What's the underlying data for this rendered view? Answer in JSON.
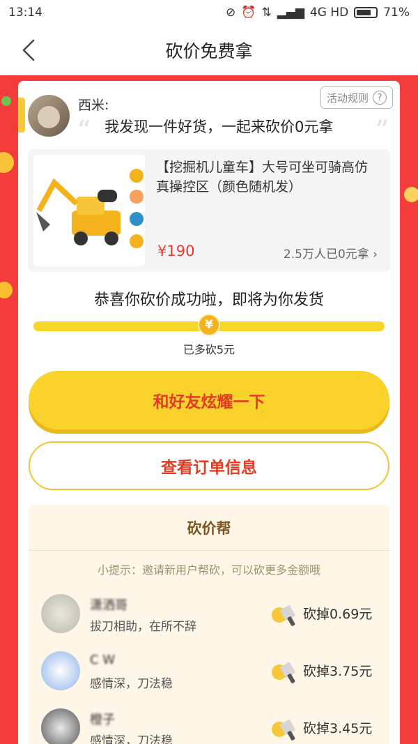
{
  "status": {
    "time": "13:14",
    "network": "4G HD",
    "battery": "71%"
  },
  "nav": {
    "title": "砍价免费拿"
  },
  "share_card": {
    "user_name": "西米:",
    "rules_label": "活动规则",
    "message": "我发现一件好货，一起来砍价0元拿"
  },
  "product": {
    "title": "【挖掘机儿童车】大号可坐可骑高仿真操控区（颜色随机发）",
    "price": "¥190",
    "sold": "2.5万人已0元拿"
  },
  "progress": {
    "congrats": "恭喜你砍价成功啦，即将为你发货",
    "coin_symbol": "¥",
    "label": "已多砍5元",
    "fraction": 0.5
  },
  "buttons": {
    "share": "和好友炫耀一下",
    "order": "查看订单信息"
  },
  "helper": {
    "title": "砍价帮",
    "tip": "小提示：邀请新用户帮砍，可以砍更多金额哦",
    "rows": [
      {
        "name": "潇洒哥",
        "desc": "拔刀相助，在所不辞",
        "amount": "砍掉0.69元"
      },
      {
        "name": "C W",
        "desc": "感情深，刀法稳",
        "amount": "砍掉3.75元"
      },
      {
        "name": "橙子",
        "desc": "感情深，刀法稳",
        "amount": "砍掉3.45元"
      }
    ]
  },
  "colors": {
    "red_bg": "#f43d3a",
    "yellow": "#f9d22c",
    "accent_red": "#e23c23"
  }
}
